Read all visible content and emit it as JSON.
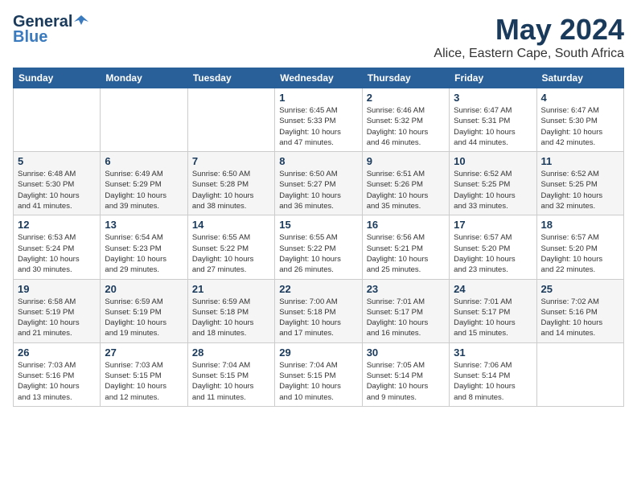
{
  "logo": {
    "general": "General",
    "blue": "Blue"
  },
  "title": "May 2024",
  "location": "Alice, Eastern Cape, South Africa",
  "weekdays": [
    "Sunday",
    "Monday",
    "Tuesday",
    "Wednesday",
    "Thursday",
    "Friday",
    "Saturday"
  ],
  "weeks": [
    [
      {
        "day": "",
        "detail": ""
      },
      {
        "day": "",
        "detail": ""
      },
      {
        "day": "",
        "detail": ""
      },
      {
        "day": "1",
        "detail": "Sunrise: 6:45 AM\nSunset: 5:33 PM\nDaylight: 10 hours\nand 47 minutes."
      },
      {
        "day": "2",
        "detail": "Sunrise: 6:46 AM\nSunset: 5:32 PM\nDaylight: 10 hours\nand 46 minutes."
      },
      {
        "day": "3",
        "detail": "Sunrise: 6:47 AM\nSunset: 5:31 PM\nDaylight: 10 hours\nand 44 minutes."
      },
      {
        "day": "4",
        "detail": "Sunrise: 6:47 AM\nSunset: 5:30 PM\nDaylight: 10 hours\nand 42 minutes."
      }
    ],
    [
      {
        "day": "5",
        "detail": "Sunrise: 6:48 AM\nSunset: 5:30 PM\nDaylight: 10 hours\nand 41 minutes."
      },
      {
        "day": "6",
        "detail": "Sunrise: 6:49 AM\nSunset: 5:29 PM\nDaylight: 10 hours\nand 39 minutes."
      },
      {
        "day": "7",
        "detail": "Sunrise: 6:50 AM\nSunset: 5:28 PM\nDaylight: 10 hours\nand 38 minutes."
      },
      {
        "day": "8",
        "detail": "Sunrise: 6:50 AM\nSunset: 5:27 PM\nDaylight: 10 hours\nand 36 minutes."
      },
      {
        "day": "9",
        "detail": "Sunrise: 6:51 AM\nSunset: 5:26 PM\nDaylight: 10 hours\nand 35 minutes."
      },
      {
        "day": "10",
        "detail": "Sunrise: 6:52 AM\nSunset: 5:25 PM\nDaylight: 10 hours\nand 33 minutes."
      },
      {
        "day": "11",
        "detail": "Sunrise: 6:52 AM\nSunset: 5:25 PM\nDaylight: 10 hours\nand 32 minutes."
      }
    ],
    [
      {
        "day": "12",
        "detail": "Sunrise: 6:53 AM\nSunset: 5:24 PM\nDaylight: 10 hours\nand 30 minutes."
      },
      {
        "day": "13",
        "detail": "Sunrise: 6:54 AM\nSunset: 5:23 PM\nDaylight: 10 hours\nand 29 minutes."
      },
      {
        "day": "14",
        "detail": "Sunrise: 6:55 AM\nSunset: 5:22 PM\nDaylight: 10 hours\nand 27 minutes."
      },
      {
        "day": "15",
        "detail": "Sunrise: 6:55 AM\nSunset: 5:22 PM\nDaylight: 10 hours\nand 26 minutes."
      },
      {
        "day": "16",
        "detail": "Sunrise: 6:56 AM\nSunset: 5:21 PM\nDaylight: 10 hours\nand 25 minutes."
      },
      {
        "day": "17",
        "detail": "Sunrise: 6:57 AM\nSunset: 5:20 PM\nDaylight: 10 hours\nand 23 minutes."
      },
      {
        "day": "18",
        "detail": "Sunrise: 6:57 AM\nSunset: 5:20 PM\nDaylight: 10 hours\nand 22 minutes."
      }
    ],
    [
      {
        "day": "19",
        "detail": "Sunrise: 6:58 AM\nSunset: 5:19 PM\nDaylight: 10 hours\nand 21 minutes."
      },
      {
        "day": "20",
        "detail": "Sunrise: 6:59 AM\nSunset: 5:19 PM\nDaylight: 10 hours\nand 19 minutes."
      },
      {
        "day": "21",
        "detail": "Sunrise: 6:59 AM\nSunset: 5:18 PM\nDaylight: 10 hours\nand 18 minutes."
      },
      {
        "day": "22",
        "detail": "Sunrise: 7:00 AM\nSunset: 5:18 PM\nDaylight: 10 hours\nand 17 minutes."
      },
      {
        "day": "23",
        "detail": "Sunrise: 7:01 AM\nSunset: 5:17 PM\nDaylight: 10 hours\nand 16 minutes."
      },
      {
        "day": "24",
        "detail": "Sunrise: 7:01 AM\nSunset: 5:17 PM\nDaylight: 10 hours\nand 15 minutes."
      },
      {
        "day": "25",
        "detail": "Sunrise: 7:02 AM\nSunset: 5:16 PM\nDaylight: 10 hours\nand 14 minutes."
      }
    ],
    [
      {
        "day": "26",
        "detail": "Sunrise: 7:03 AM\nSunset: 5:16 PM\nDaylight: 10 hours\nand 13 minutes."
      },
      {
        "day": "27",
        "detail": "Sunrise: 7:03 AM\nSunset: 5:15 PM\nDaylight: 10 hours\nand 12 minutes."
      },
      {
        "day": "28",
        "detail": "Sunrise: 7:04 AM\nSunset: 5:15 PM\nDaylight: 10 hours\nand 11 minutes."
      },
      {
        "day": "29",
        "detail": "Sunrise: 7:04 AM\nSunset: 5:15 PM\nDaylight: 10 hours\nand 10 minutes."
      },
      {
        "day": "30",
        "detail": "Sunrise: 7:05 AM\nSunset: 5:14 PM\nDaylight: 10 hours\nand 9 minutes."
      },
      {
        "day": "31",
        "detail": "Sunrise: 7:06 AM\nSunset: 5:14 PM\nDaylight: 10 hours\nand 8 minutes."
      },
      {
        "day": "",
        "detail": ""
      }
    ]
  ]
}
